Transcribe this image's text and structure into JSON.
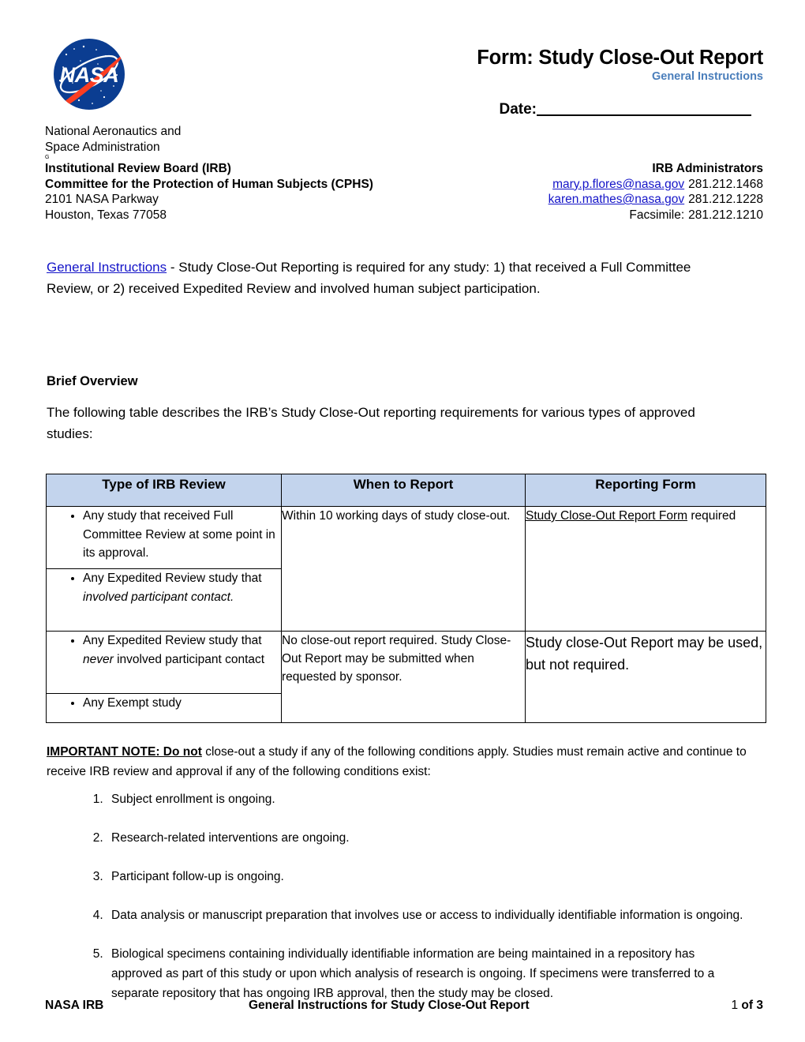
{
  "header": {
    "logo_alt": "NASA insignia",
    "agency_name": "National Aeronautics and\nSpace Administration",
    "g_mark": "G",
    "org_line1": "Institutional Review Board (IRB)",
    "org_line2": "Committee for the Protection of Human Subjects (CPHS)",
    "org_line3": "2101 NASA Parkway",
    "org_line4": "Houston, Texas 77058",
    "form_title": "Form:  Study Close-Out Report",
    "form_subtitle": "General Instructions",
    "date_label": "Date:",
    "admins_title": "IRB Administrators",
    "admin1_email": "mary.p.flores@nasa.gov",
    "admin1_phone": "281.212.1468",
    "admin2_email": "karen.mathes@nasa.gov",
    "admin2_phone": "281.212.1228",
    "fax_label": "Facsimile:",
    "fax_number": "281.212.1210"
  },
  "intro": {
    "link_text": "General Instructions",
    "body": " - Study Close-Out Reporting is required for any study:  1) that received a Full Committee Review, or 2) received Expedited Review and involved human subject participation."
  },
  "overview": {
    "heading": "Brief Overview",
    "text": "The following table describes the IRB’s Study Close-Out reporting requirements for various types of approved studies:"
  },
  "table": {
    "headers": [
      "Type of IRB Review",
      "When to Report",
      "Reporting Form"
    ],
    "group1": {
      "bullets_a": [
        "Any study that received Full Committee Review at some point in its approval."
      ],
      "bullets_b_pre": "Any Expedited Review study that ",
      "bullets_b_em": "involved participant contact.",
      "when": "Within 10 working days of study close-out.",
      "form_link": "Study Close-Out Report Form",
      "form_rest": " required"
    },
    "group2": {
      "bullets_a_pre": "Any Expedited Review study that ",
      "bullets_a_em": "never",
      "bullets_a_post": " involved participant contact",
      "bullets_b": [
        "Any Exempt study"
      ],
      "when": "No close-out report required.  Study Close-Out Report may be submitted when requested by sponsor.",
      "form": "Study close-Out Report may be used, but not required."
    }
  },
  "note": {
    "label": "IMPORTANT NOTE:  Do not",
    "body": " close-out a study if any of the following conditions apply.  Studies must remain active and continue to receive IRB review and approval if any of the following conditions exist:"
  },
  "conditions": [
    "Subject enrollment is ongoing.",
    "Research-related interventions are ongoing.",
    "Participant follow-up is ongoing.",
    "Data analysis or manuscript preparation that involves use or access to individually identifiable information is ongoing.",
    "Biological specimens containing individually identifiable information are being maintained in a repository has approved as part of this study or upon which analysis of research is ongoing.  If specimens were transferred to a separate repository that has ongoing IRB approval, then the study may be closed."
  ],
  "footer": {
    "left": "NASA IRB",
    "center": "General Instructions for Study Close-Out Report",
    "page_num": "1",
    "page_of": " of 3"
  },
  "colors": {
    "table_header_bg": "#c3d4ed",
    "subtitle_blue": "#4a7ebb",
    "link_blue": "#1414c8",
    "nasa_blue": "#0b3d91",
    "nasa_red": "#fc3d21"
  }
}
